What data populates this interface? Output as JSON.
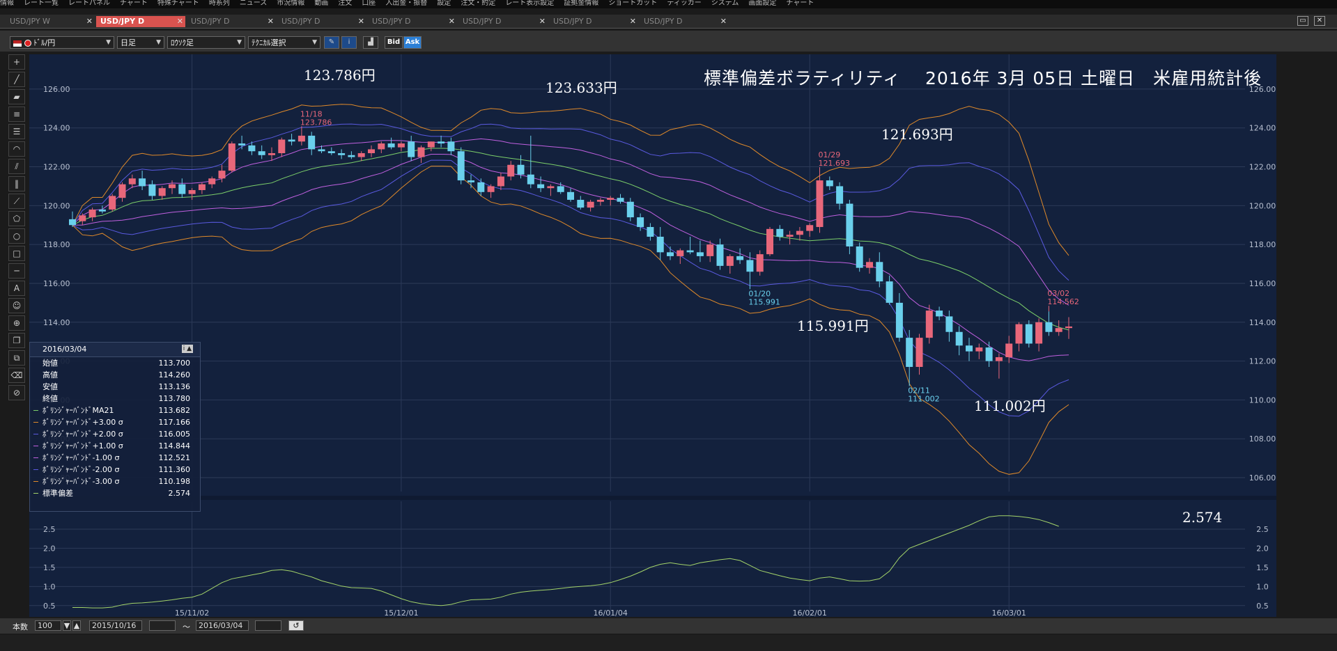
{
  "menubar": {
    "items": [
      "情報",
      "レート一覧",
      "レートパネル",
      "チャート",
      "特殊チャート",
      "時系列",
      "ニュース",
      "市況情報",
      "動画",
      "注文",
      "口座",
      "入出金・振替",
      "設定",
      "注文・約定",
      "レート表示設定",
      "証拠金情報",
      "ショートカット",
      "ティッカー",
      "システム",
      "画面設定",
      "チャート"
    ]
  },
  "tabs": [
    {
      "label": "USD/JPY W",
      "active": false
    },
    {
      "label": "USD/JPY D",
      "active": true
    },
    {
      "label": "USD/JPY D",
      "active": false
    },
    {
      "label": "USD/JPY D",
      "active": false
    },
    {
      "label": "USD/JPY D",
      "active": false
    },
    {
      "label": "USD/JPY D",
      "active": false
    },
    {
      "label": "USD/JPY D",
      "active": false
    },
    {
      "label": "USD/JPY D",
      "active": false
    }
  ],
  "toolbar": {
    "pair": "ﾄﾞﾙ/円",
    "period": "日足",
    "candle_type": "ﾛｳｿｸ足",
    "technical": "ﾃｸﾆｶﾙ選択",
    "bid": "Bid",
    "ask": "Ask"
  },
  "chart_title": "標準偏差ボラティリティ　 2016年 3月 05日 土曜日　米雇用統計後",
  "annotations": {
    "a1": "123.786円",
    "a2": "123.633円",
    "a3": "121.693円",
    "a4": "115.991円",
    "a5": "111.002円",
    "sd": "2.574"
  },
  "markers": {
    "m1_date": "11/18",
    "m1_val": "123.786",
    "m2_date": "01/29",
    "m2_val": "121.693",
    "m3_date": "01/20",
    "m3_val": "115.991",
    "m4_date": "02/11",
    "m4_val": "111.002",
    "m5_date": "03/02",
    "m5_val": "114.562"
  },
  "info_panel": {
    "date": "2016/03/04",
    "rows": [
      {
        "label": "始値",
        "value": "113.700",
        "color": ""
      },
      {
        "label": "高値",
        "value": "114.260",
        "color": ""
      },
      {
        "label": "安値",
        "value": "113.136",
        "color": ""
      },
      {
        "label": "終値",
        "value": "113.780",
        "color": ""
      },
      {
        "label": "ﾎﾞﾘﾝｼﾞｬｰﾊﾞﾝﾄﾞMA21",
        "value": "113.682",
        "color": "#7ccf6a"
      },
      {
        "label": "ﾎﾞﾘﾝｼﾞｬｰﾊﾞﾝﾄﾞ+3.00 σ",
        "value": "117.166",
        "color": "#e08a2a"
      },
      {
        "label": "ﾎﾞﾘﾝｼﾞｬｰﾊﾞﾝﾄﾞ+2.00 σ",
        "value": "116.005",
        "color": "#5a5ae0"
      },
      {
        "label": "ﾎﾞﾘﾝｼﾞｬｰﾊﾞﾝﾄﾞ+1.00 σ",
        "value": "114.844",
        "color": "#c060e0"
      },
      {
        "label": "ﾎﾞﾘﾝｼﾞｬｰﾊﾞﾝﾄﾞ-1.00 σ",
        "value": "112.521",
        "color": "#c060e0"
      },
      {
        "label": "ﾎﾞﾘﾝｼﾞｬｰﾊﾞﾝﾄﾞ-2.00 σ",
        "value": "111.360",
        "color": "#5a5ae0"
      },
      {
        "label": "ﾎﾞﾘﾝｼﾞｬｰﾊﾞﾝﾄﾞ-3.00 σ",
        "value": "110.198",
        "color": "#e08a2a"
      },
      {
        "label": "標準偏差",
        "value": "2.574",
        "color": "#a4d46a"
      }
    ]
  },
  "bottom": {
    "count_label": "本数",
    "count": "100",
    "from": "2015/10/16",
    "tilde": "〜",
    "to": "2016/03/04"
  },
  "colors": {
    "bg": "#13213d",
    "up": "#e8677a",
    "down": "#6ad0ec",
    "ma": "#7ccf6a",
    "s1": "#c060e0",
    "s2": "#5a5ae0",
    "s3": "#e08a2a",
    "sd": "#a4d46a",
    "grid": "#2c3a58"
  },
  "chart_data": [
    {
      "type": "candlestick",
      "ylim": [
        105.5,
        127.0
      ],
      "yticks": [
        "126.00",
        "124.00",
        "122.00",
        "120.00",
        "118.00",
        "116.00",
        "114.00",
        "112.00",
        "110.00",
        "108.00",
        "106.00"
      ],
      "xticks": [
        "15/11/02",
        "15/12/01",
        "16/01/04",
        "16/02/01",
        "16/03/01"
      ],
      "ohlc": [
        [
          119.3,
          119.7,
          118.9,
          119.0
        ],
        [
          119.2,
          119.6,
          119.0,
          119.5
        ],
        [
          119.4,
          119.9,
          119.2,
          119.8
        ],
        [
          119.8,
          120.0,
          119.6,
          119.7
        ],
        [
          119.8,
          120.6,
          119.7,
          120.5
        ],
        [
          120.4,
          121.2,
          120.2,
          121.1
        ],
        [
          121.1,
          121.6,
          120.9,
          121.4
        ],
        [
          121.4,
          121.8,
          120.8,
          121.0
        ],
        [
          121.1,
          121.3,
          120.3,
          120.5
        ],
        [
          120.5,
          121.0,
          120.3,
          120.9
        ],
        [
          120.9,
          121.3,
          120.6,
          121.1
        ],
        [
          121.1,
          121.4,
          120.4,
          120.6
        ],
        [
          120.6,
          120.9,
          120.3,
          120.8
        ],
        [
          120.8,
          121.2,
          120.6,
          121.1
        ],
        [
          121.1,
          121.5,
          120.9,
          121.4
        ],
        [
          121.4,
          122.1,
          121.2,
          121.8
        ],
        [
          121.8,
          123.3,
          121.7,
          123.2
        ],
        [
          123.2,
          123.6,
          122.9,
          123.1
        ],
        [
          123.1,
          123.3,
          122.6,
          122.8
        ],
        [
          122.8,
          123.1,
          122.4,
          122.6
        ],
        [
          122.6,
          123.0,
          122.3,
          122.7
        ],
        [
          122.7,
          123.5,
          122.5,
          123.4
        ],
        [
          123.4,
          123.7,
          123.1,
          123.3
        ],
        [
          123.3,
          123.8,
          123.1,
          123.6
        ],
        [
          123.6,
          123.8,
          122.6,
          122.9
        ],
        [
          122.9,
          123.1,
          122.7,
          122.8
        ],
        [
          122.8,
          123.0,
          122.6,
          122.7
        ],
        [
          122.7,
          122.9,
          122.4,
          122.6
        ],
        [
          122.6,
          122.8,
          122.4,
          122.5
        ],
        [
          122.5,
          122.8,
          122.3,
          122.7
        ],
        [
          122.7,
          123.1,
          122.5,
          122.9
        ],
        [
          122.9,
          123.3,
          122.7,
          123.2
        ],
        [
          123.2,
          123.5,
          122.9,
          123.0
        ],
        [
          123.0,
          123.3,
          122.8,
          123.2
        ],
        [
          123.3,
          123.6,
          122.3,
          122.5
        ],
        [
          122.5,
          123.1,
          122.2,
          123.0
        ],
        [
          123.0,
          123.3,
          122.8,
          123.3
        ],
        [
          123.3,
          123.6,
          123.0,
          123.2
        ],
        [
          123.3,
          123.5,
          122.6,
          122.8
        ],
        [
          122.8,
          123.0,
          121.1,
          121.3
        ],
        [
          121.3,
          121.6,
          120.9,
          121.2
        ],
        [
          121.2,
          121.4,
          120.5,
          120.7
        ],
        [
          120.7,
          121.1,
          120.4,
          121.0
        ],
        [
          121.0,
          121.7,
          120.8,
          121.5
        ],
        [
          121.5,
          122.3,
          121.3,
          122.1
        ],
        [
          122.1,
          122.6,
          121.4,
          121.6
        ],
        [
          121.6,
          123.6,
          120.9,
          121.1
        ],
        [
          121.1,
          121.5,
          120.7,
          120.9
        ],
        [
          120.9,
          121.1,
          120.5,
          121.0
        ],
        [
          121.0,
          121.2,
          120.6,
          120.7
        ],
        [
          120.7,
          120.9,
          120.2,
          120.3
        ],
        [
          120.3,
          120.5,
          119.8,
          119.9
        ],
        [
          119.9,
          120.3,
          119.7,
          120.2
        ],
        [
          120.2,
          120.4,
          120.0,
          120.3
        ],
        [
          120.3,
          120.5,
          120.0,
          120.4
        ],
        [
          120.4,
          120.6,
          120.1,
          120.2
        ],
        [
          120.2,
          120.4,
          119.2,
          119.4
        ],
        [
          119.4,
          119.6,
          118.7,
          118.9
        ],
        [
          118.9,
          119.1,
          118.2,
          118.4
        ],
        [
          118.4,
          118.9,
          117.2,
          117.6
        ],
        [
          117.6,
          117.9,
          117.2,
          117.4
        ],
        [
          117.4,
          117.8,
          117.0,
          117.7
        ],
        [
          117.7,
          118.4,
          117.5,
          117.6
        ],
        [
          117.6,
          118.2,
          117.1,
          117.4
        ],
        [
          117.4,
          118.2,
          117.1,
          118.0
        ],
        [
          118.0,
          118.3,
          116.7,
          116.9
        ],
        [
          116.9,
          117.5,
          116.5,
          117.4
        ],
        [
          117.4,
          117.8,
          117.0,
          117.2
        ],
        [
          117.2,
          117.6,
          115.99,
          116.6
        ],
        [
          116.6,
          117.7,
          116.4,
          117.5
        ],
        [
          117.5,
          118.9,
          117.4,
          118.8
        ],
        [
          118.8,
          119.0,
          118.2,
          118.4
        ],
        [
          118.4,
          118.7,
          118.0,
          118.5
        ],
        [
          118.5,
          118.9,
          118.2,
          118.7
        ],
        [
          118.7,
          119.1,
          118.4,
          119.0
        ],
        [
          118.9,
          121.69,
          118.6,
          121.3
        ],
        [
          121.3,
          121.5,
          120.8,
          121.0
        ],
        [
          121.0,
          121.2,
          119.8,
          120.1
        ],
        [
          120.1,
          120.3,
          117.5,
          117.9
        ],
        [
          117.9,
          118.1,
          116.6,
          116.8
        ],
        [
          116.8,
          117.3,
          116.5,
          117.1
        ],
        [
          117.1,
          117.6,
          115.8,
          116.1
        ],
        [
          116.1,
          116.4,
          114.9,
          115.0
        ],
        [
          115.0,
          115.5,
          113.0,
          113.2
        ],
        [
          113.2,
          113.6,
          111.0,
          111.7
        ],
        [
          111.7,
          113.4,
          111.3,
          113.2
        ],
        [
          113.2,
          114.9,
          112.9,
          114.6
        ],
        [
          114.6,
          114.8,
          114.1,
          114.3
        ],
        [
          114.3,
          114.6,
          113.0,
          113.5
        ],
        [
          113.5,
          113.8,
          112.3,
          112.8
        ],
        [
          112.8,
          113.2,
          112.0,
          112.5
        ],
        [
          112.5,
          112.9,
          112.1,
          112.7
        ],
        [
          112.7,
          113.0,
          111.7,
          112.0
        ],
        [
          112.0,
          112.4,
          111.1,
          112.2
        ],
        [
          112.2,
          113.3,
          111.9,
          112.9
        ],
        [
          112.9,
          114.0,
          112.5,
          113.9
        ],
        [
          113.9,
          114.1,
          112.7,
          112.9
        ],
        [
          112.9,
          114.2,
          112.5,
          114.0
        ],
        [
          114.0,
          114.56,
          113.3,
          113.5
        ],
        [
          113.5,
          114.1,
          113.3,
          113.7
        ],
        [
          113.7,
          114.26,
          113.14,
          113.78
        ]
      ]
    },
    {
      "type": "line",
      "name": "標準偏差",
      "ylim": [
        0.35,
        2.9
      ],
      "yticks": [
        "2.5",
        "2.0",
        "1.5",
        "1.0",
        "0.5"
      ],
      "values": [
        0.45,
        0.45,
        0.44,
        0.44,
        0.46,
        0.52,
        0.56,
        0.57,
        0.59,
        0.62,
        0.65,
        0.69,
        0.72,
        0.8,
        0.95,
        1.1,
        1.2,
        1.25,
        1.3,
        1.35,
        1.42,
        1.44,
        1.4,
        1.32,
        1.25,
        1.15,
        1.08,
        1.01,
        0.97,
        0.96,
        0.95,
        0.88,
        0.78,
        0.68,
        0.6,
        0.55,
        0.52,
        0.5,
        0.53,
        0.6,
        0.65,
        0.66,
        0.67,
        0.72,
        0.8,
        0.85,
        0.88,
        0.9,
        0.92,
        0.95,
        0.98,
        1.0,
        1.02,
        1.05,
        1.1,
        1.18,
        1.27,
        1.38,
        1.5,
        1.58,
        1.62,
        1.58,
        1.55,
        1.62,
        1.66,
        1.7,
        1.73,
        1.68,
        1.55,
        1.42,
        1.35,
        1.28,
        1.22,
        1.18,
        1.15,
        1.22,
        1.25,
        1.2,
        1.15,
        1.14,
        1.15,
        1.2,
        1.4,
        1.75,
        2.0,
        2.1,
        2.2,
        2.3,
        2.4,
        2.5,
        2.6,
        2.72,
        2.82,
        2.85,
        2.85,
        2.83,
        2.8,
        2.75,
        2.67,
        2.574
      ]
    }
  ]
}
